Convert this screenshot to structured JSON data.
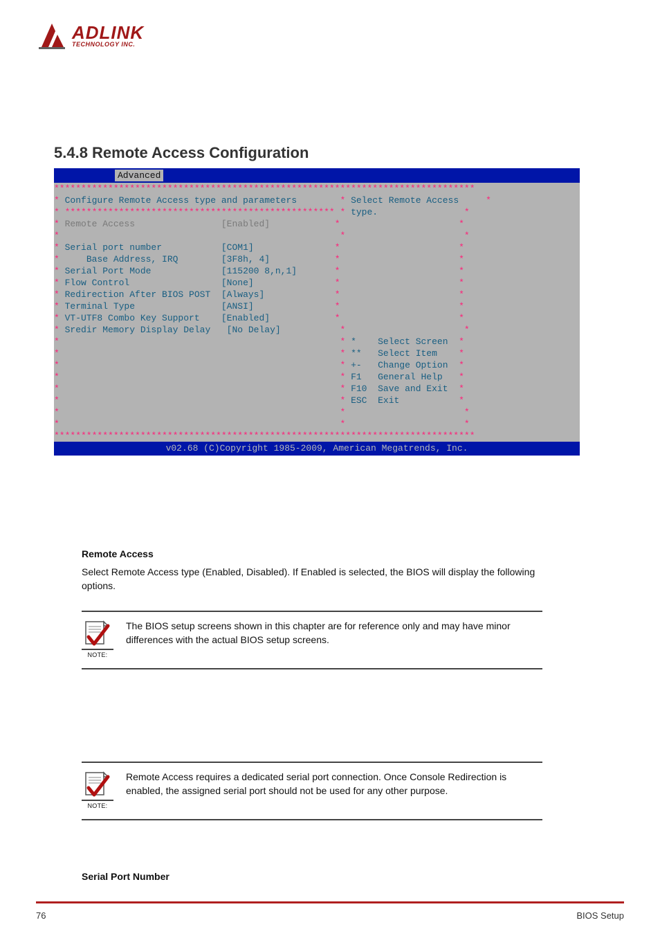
{
  "logo": {
    "main": "ADLINK",
    "sub": "TECHNOLOGY INC."
  },
  "section_heading": "5.4.8 Remote Access Configuration",
  "bios": {
    "active_tab": "Advanced",
    "title_left": "Configure Remote Access type and parameters",
    "help_line1": "Select Remote Access",
    "help_line2": "type.",
    "selected_item": {
      "label": "Remote Access",
      "value": "[Enabled]"
    },
    "items": [
      {
        "label": "Serial port number",
        "value": "[COM1]"
      },
      {
        "label": "    Base Address, IRQ",
        "value": "[3F8h, 4]"
      },
      {
        "label": "Serial Port Mode",
        "value": "[115200 8,n,1]"
      },
      {
        "label": "Flow Control",
        "value": "[None]"
      },
      {
        "label": "Redirection After BIOS POST",
        "value": "[Always]"
      },
      {
        "label": "Terminal Type",
        "value": "[ANSI]"
      },
      {
        "label": "VT-UTF8 Combo Key Support",
        "value": "[Enabled]"
      },
      {
        "label": "Sredir Memory Display Delay",
        "value": "[No Delay]"
      }
    ],
    "nav": [
      {
        "key": "*",
        "action": "Select Screen"
      },
      {
        "key": "**",
        "action": "Select Item"
      },
      {
        "key": "+-",
        "action": "Change Option"
      },
      {
        "key": "F1",
        "action": "General Help"
      },
      {
        "key": "F10",
        "action": "Save and Exit"
      },
      {
        "key": "ESC",
        "action": "Exit"
      }
    ],
    "footer": "v02.68 (C)Copyright 1985-2009, American Megatrends, Inc."
  },
  "remote_access_heading": "Remote Access",
  "remote_access_body": "Select Remote Access type (Enabled, Disabled). If Enabled is selected, the BIOS will display the following options.",
  "note1": {
    "label": "NOTE:",
    "text": "The BIOS setup screens shown in this chapter are for reference only and may have minor differences with the actual BIOS setup screens."
  },
  "note2": {
    "label": "NOTE:",
    "text": "Remote Access requires a dedicated serial port connection. Once Console Redirection is enabled, the assigned serial port should not be used for any other purpose."
  },
  "serial_port_heading": "Serial Port Number",
  "page_number": "76",
  "doc_title": "BIOS Setup  "
}
